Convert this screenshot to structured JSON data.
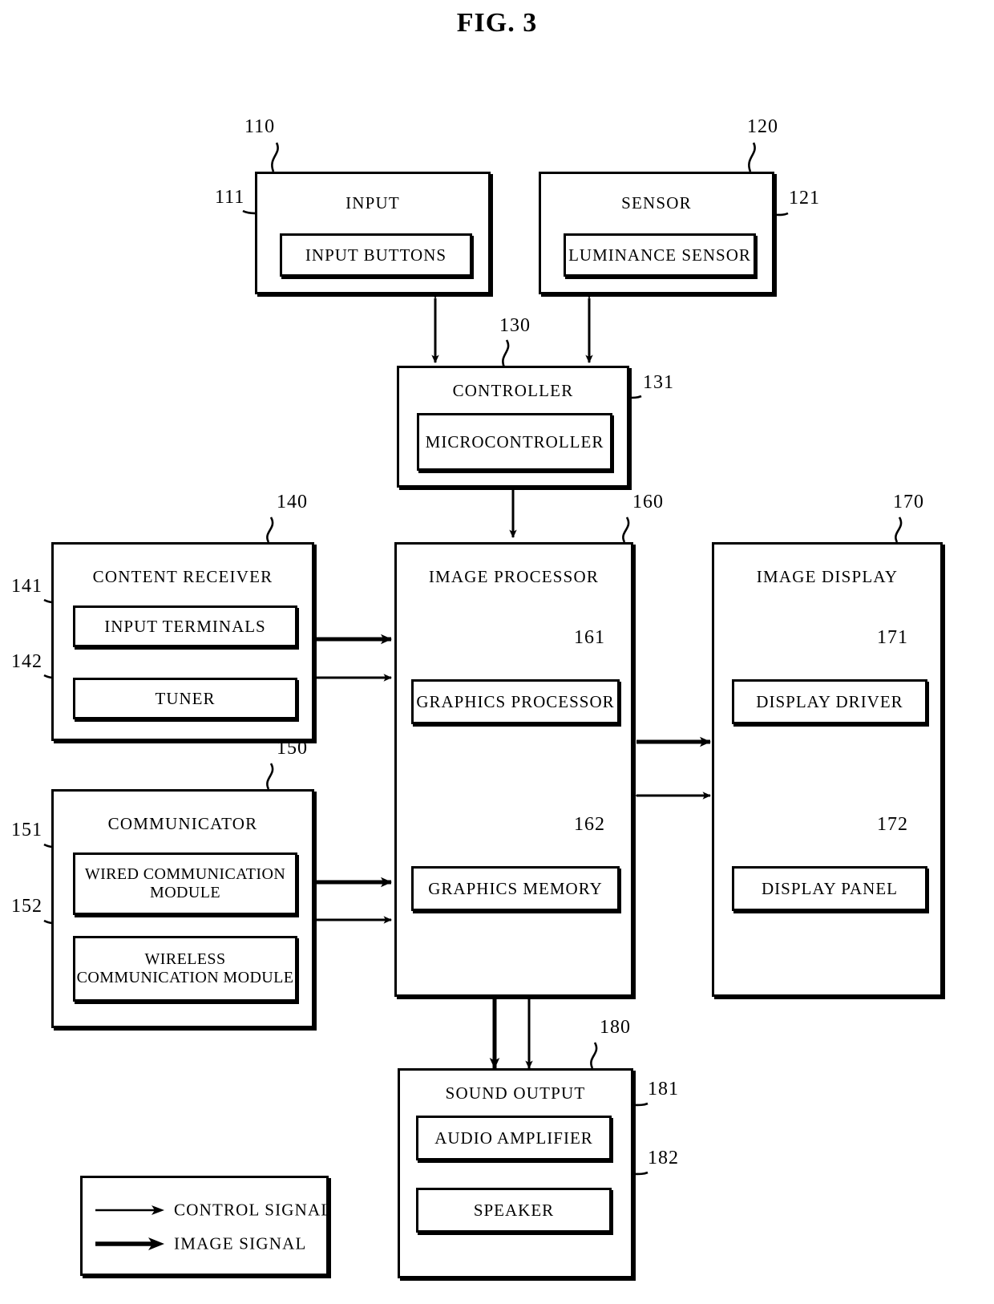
{
  "figure": {
    "title": "FIG. 3",
    "type": "block-diagram"
  },
  "blocks": [
    {
      "id": "input",
      "ref": "110",
      "title": "INPUT",
      "children": [
        {
          "id": "input-buttons",
          "ref": "111",
          "label": "INPUT BUTTONS"
        }
      ]
    },
    {
      "id": "sensor",
      "ref": "120",
      "title": "SENSOR",
      "children": [
        {
          "id": "luminance-sensor",
          "ref": "121",
          "label": "LUMINANCE SENSOR"
        }
      ]
    },
    {
      "id": "controller",
      "ref": "130",
      "title": "CONTROLLER",
      "children": [
        {
          "id": "microcontroller",
          "ref": "131",
          "label": "MICROCONTROLLER"
        }
      ]
    },
    {
      "id": "content-receiver",
      "ref": "140",
      "title": "CONTENT RECEIVER",
      "children": [
        {
          "id": "input-terminals",
          "ref": "141",
          "label": "INPUT TERMINALS"
        },
        {
          "id": "tuner",
          "ref": "142",
          "label": "TUNER"
        }
      ]
    },
    {
      "id": "communicator",
      "ref": "150",
      "title": "COMMUNICATOR",
      "children": [
        {
          "id": "wired-communication-module",
          "ref": "151",
          "label": "WIRED COMMUNICATION MODULE"
        },
        {
          "id": "wireless-communication-module",
          "ref": "152",
          "label": "WIRELESS COMMUNICATION MODULE"
        }
      ]
    },
    {
      "id": "image-processor",
      "ref": "160",
      "title": "IMAGE PROCESSOR",
      "children": [
        {
          "id": "graphics-processor",
          "ref": "161",
          "label": "GRAPHICS PROCESSOR"
        },
        {
          "id": "graphics-memory",
          "ref": "162",
          "label": "GRAPHICS MEMORY"
        }
      ]
    },
    {
      "id": "image-display",
      "ref": "170",
      "title": "IMAGE DISPLAY",
      "children": [
        {
          "id": "display-driver",
          "ref": "171",
          "label": "DISPLAY DRIVER"
        },
        {
          "id": "display-panel",
          "ref": "172",
          "label": "DISPLAY PANEL"
        }
      ]
    },
    {
      "id": "sound-output",
      "ref": "180",
      "title": "SOUND OUTPUT",
      "children": [
        {
          "id": "audio-amplifier",
          "ref": "181",
          "label": "AUDIO AMPLIFIER"
        },
        {
          "id": "speaker",
          "ref": "182",
          "label": "SPEAKER"
        }
      ]
    }
  ],
  "legend": {
    "items": [
      {
        "id": "control-signal",
        "label": "CONTROL SIGNAL",
        "style": "thin-arrow"
      },
      {
        "id": "image-signal",
        "label": "IMAGE SIGNAL",
        "style": "thick-arrow"
      }
    ]
  },
  "refs": {
    "r110": "110",
    "r111": "111",
    "r120": "120",
    "r121": "121",
    "r130": "130",
    "r131": "131",
    "r140": "140",
    "r141": "141",
    "r142": "142",
    "r150": "150",
    "r151": "151",
    "r152": "152",
    "r160": "160",
    "r161": "161",
    "r162": "162",
    "r170": "170",
    "r171": "171",
    "r172": "172",
    "r180": "180",
    "r181": "181",
    "r182": "182"
  },
  "colors": {
    "line": "#000000",
    "background": "#ffffff"
  }
}
